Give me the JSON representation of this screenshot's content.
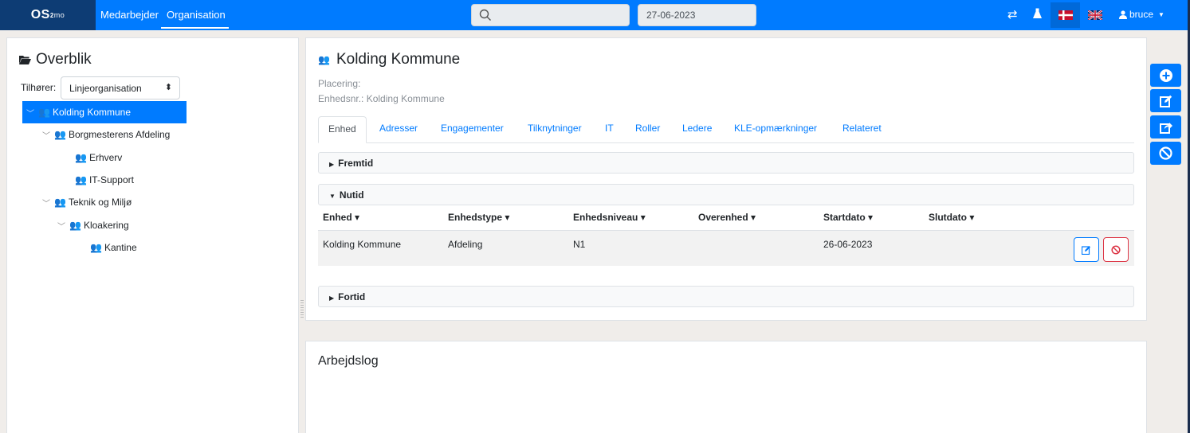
{
  "navbar": {
    "brand_main": "OS",
    "brand_sup": "2",
    "brand_sub": "mo",
    "nav_links": [
      "Medarbejder",
      "Organisation"
    ],
    "date_value": "27-06-2023",
    "user": "bruce",
    "icons": [
      "search-icon",
      "switch-icon",
      "flask-icon",
      "flag-dk-icon",
      "flag-uk-icon",
      "user-icon",
      "caret-down-icon"
    ]
  },
  "sidebar": {
    "title": "Overblik",
    "belongs_label": "Tilhører:",
    "belongs_value": "Linjeorganisation",
    "tree": [
      {
        "label": "Kolding Kommune"
      },
      {
        "label": "Borgmesterens Afdeling"
      },
      {
        "label": "Erhverv"
      },
      {
        "label": "IT-Support"
      },
      {
        "label": "Teknik og Miljø"
      },
      {
        "label": "Kloakering"
      },
      {
        "label": "Kantine"
      }
    ]
  },
  "unit": {
    "title": "Kolding Kommune",
    "placering": "Placering:",
    "enhedsnr": "Enhedsnr.: Kolding Kommune",
    "tabs": [
      "Enhed",
      "Adresser",
      "Engagementer",
      "Tilknytninger",
      "IT",
      "Roller",
      "Ledere",
      "KLE-opmærkninger",
      "Relateret"
    ],
    "sections": {
      "future": "Fremtid",
      "present": "Nutid",
      "past": "Fortid"
    },
    "columns": [
      "Enhed",
      "Enhedstype",
      "Enhedsniveau",
      "Overenhed",
      "Startdato",
      "Slutdato"
    ],
    "rows": [
      {
        "enhed": "Kolding Kommune",
        "enhedstype": "Afdeling",
        "enhedsniveau": "N1",
        "overenhed": "",
        "startdato": "26-06-2023",
        "slutdato": ""
      }
    ]
  },
  "log": {
    "title": "Arbejdslog"
  },
  "colors": {
    "primary": "#007bff",
    "brand_dark": "#0d3c74",
    "danger": "#dc3545"
  }
}
